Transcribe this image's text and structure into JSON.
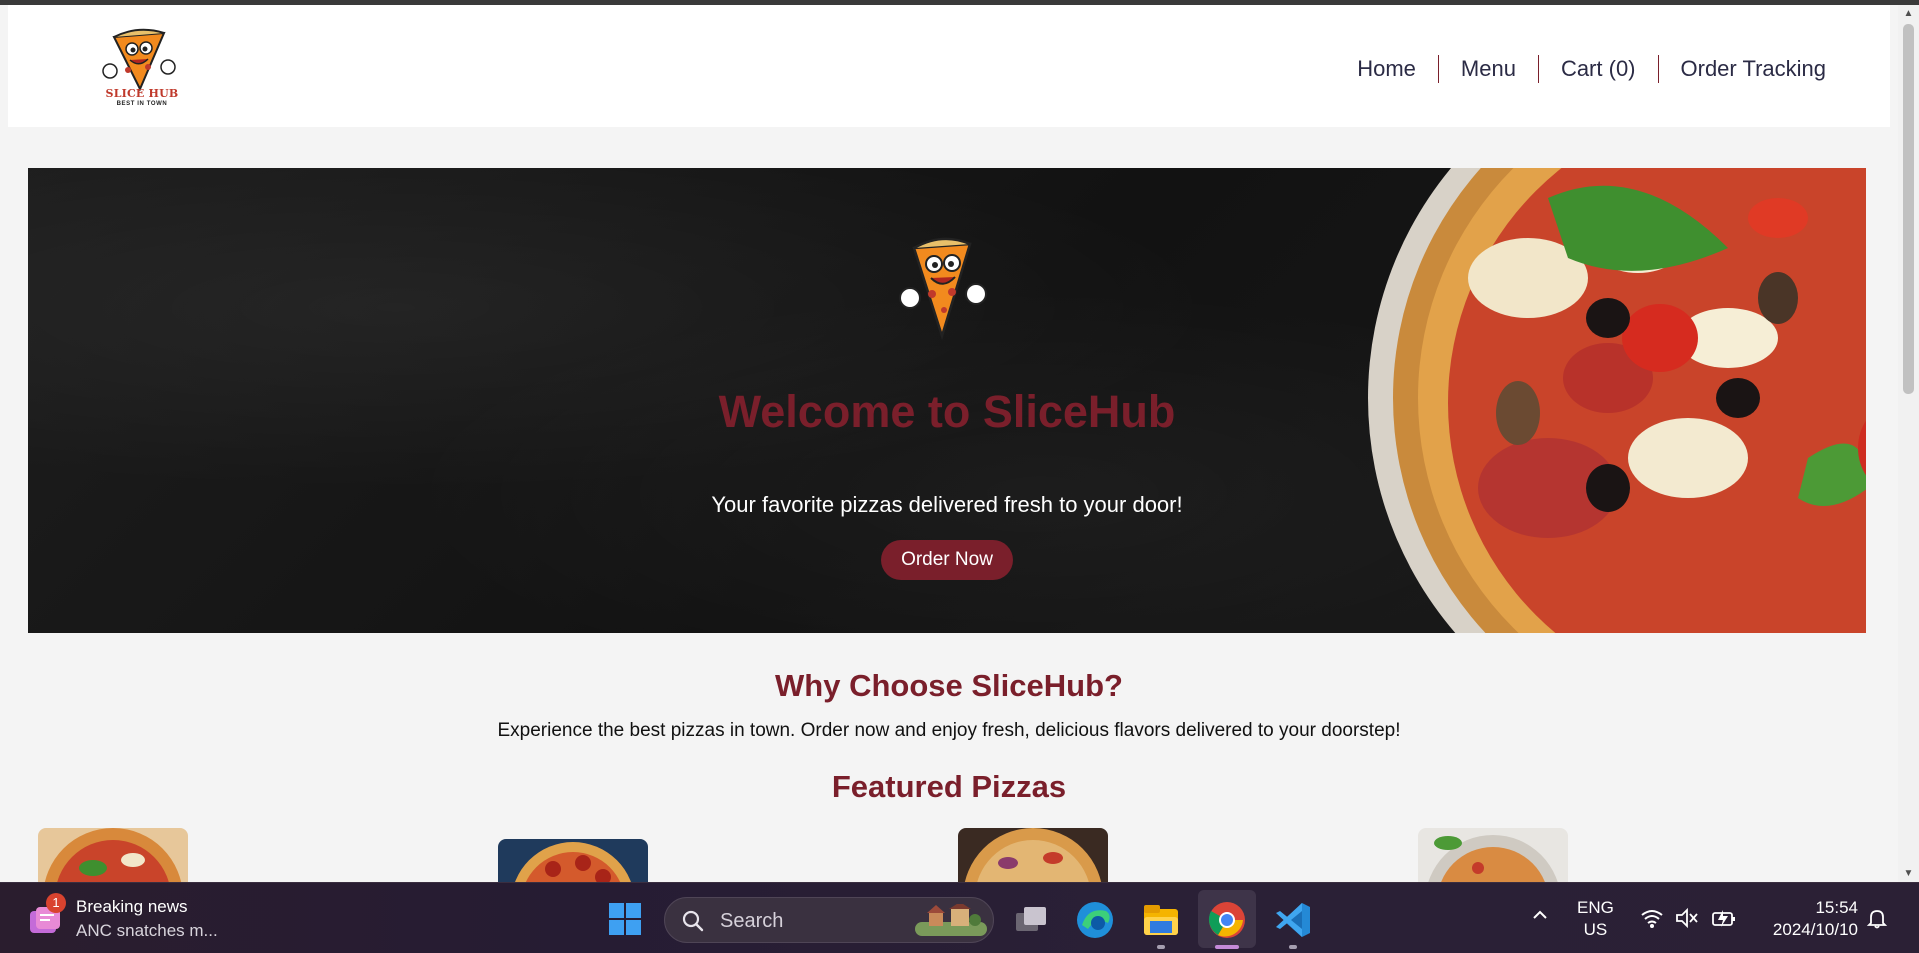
{
  "site": {
    "logo_text": "SLICE HUB",
    "logo_sub": "BEST IN TOWN",
    "nav": [
      "Home",
      "Menu",
      "Cart (0)",
      "Order Tracking"
    ]
  },
  "hero": {
    "title": "Welcome to SliceHub",
    "subtitle": "Your favorite pizzas delivered fresh to your door!",
    "button": "Order Now"
  },
  "why": {
    "title": "Why Choose SliceHub?",
    "text": "Experience the best pizzas in town. Order now and enjoy fresh, delicious flavors delivered to your doorstep!"
  },
  "featured": {
    "title": "Featured Pizzas"
  },
  "taskbar": {
    "news_badge": "1",
    "news_title": "Breaking news",
    "news_sub": "ANC snatches m...",
    "search_label": "Search",
    "lang_line1": "ENG",
    "lang_line2": "US",
    "time": "15:54",
    "date": "2024/10/10",
    "apps": [
      "task-view",
      "edge",
      "file-explorer",
      "chrome",
      "vscode"
    ]
  },
  "colors": {
    "brand_maroon": "#7a1f2b",
    "hero_bg": "#161616",
    "nav_text": "#2b2b45"
  }
}
